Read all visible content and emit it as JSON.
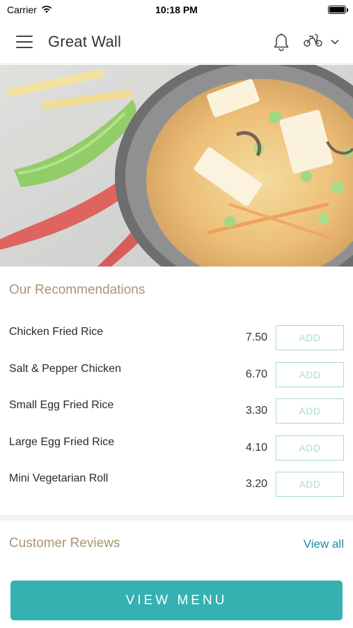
{
  "status_bar": {
    "carrier": "Carrier",
    "time": "10:18 PM"
  },
  "header": {
    "title": "Great Wall",
    "icons": [
      "menu-icon",
      "bell-icon",
      "scooter-icon",
      "chevron-down-icon"
    ]
  },
  "hero": {
    "image": "hot-and-sour-soup-with-chillies"
  },
  "recommendations": {
    "title": "Our Recommendations",
    "add_label": "ADD",
    "items": [
      {
        "name": "Chicken Fried Rice",
        "price": "7.50"
      },
      {
        "name": "Salt & Pepper Chicken",
        "price": "6.70"
      },
      {
        "name": "Small Egg Fried Rice",
        "price": "3.30"
      },
      {
        "name": "Large Egg Fried Rice",
        "price": "4.10"
      },
      {
        "name": "Mini Vegetarian Roll",
        "price": "3.20"
      }
    ]
  },
  "reviews": {
    "title": "Customer Reviews",
    "view_all": "View all"
  },
  "cta": {
    "label": "VIEW MENU"
  },
  "colors": {
    "accent": "#36b1b2",
    "section_title": "#a89673",
    "add_border": "#a9dccf",
    "link": "#1d8ea4"
  }
}
